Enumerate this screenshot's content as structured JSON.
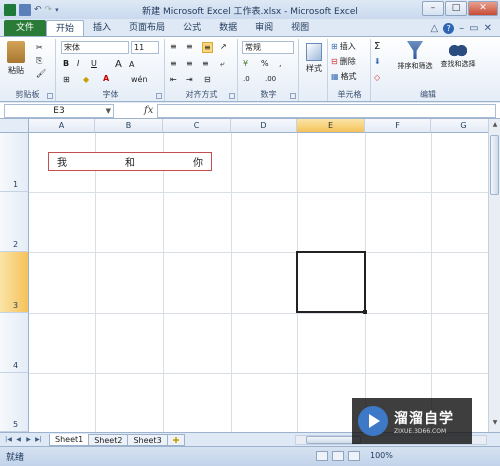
{
  "window": {
    "title": "新建 Microsoft Excel 工作表.xlsx - Microsoft Excel"
  },
  "tabs": [
    "文件",
    "开始",
    "插入",
    "页面布局",
    "公式",
    "数据",
    "审阅",
    "视图"
  ],
  "active_tab": "开始",
  "ribbon": {
    "clipboard": {
      "paste": "粘贴",
      "label": "剪贴板"
    },
    "font": {
      "name": "宋体",
      "size": "11",
      "bold": "B",
      "italic": "I",
      "underline": "U",
      "grow": "A",
      "shrink": "A",
      "color_a": "A",
      "wen": "wén",
      "label": "字体"
    },
    "alignment": {
      "label": "对齐方式"
    },
    "number": {
      "format": "常规",
      "percent": "%",
      "comma": ",",
      "dec_inc": ".0",
      "dec_dec": ".00",
      "label": "数字"
    },
    "styles": {
      "styles_btn": "样式",
      "label": ""
    },
    "cells": {
      "insert": "插入",
      "delete": "删除",
      "format": "格式",
      "label": "单元格"
    },
    "editing": {
      "sum": "Σ",
      "sort_filter": "排序和筛选",
      "find_select": "查找和选择",
      "label": "编辑"
    }
  },
  "formula_bar": {
    "name_box": "E3",
    "fx": "fx",
    "content": ""
  },
  "grid": {
    "columns": [
      "A",
      "B",
      "C",
      "D",
      "E",
      "F",
      "G"
    ],
    "rows": [
      "1",
      "2",
      "3",
      "4",
      "5"
    ],
    "selected_column": "E",
    "selected_row": "3",
    "textbox_words": [
      "我",
      "和",
      "你"
    ]
  },
  "sheets": [
    "Sheet1",
    "Sheet2",
    "Sheet3"
  ],
  "active_sheet": "Sheet1",
  "status": {
    "mode": "就绪",
    "zoom": "100%"
  },
  "watermark": {
    "brand": "溜溜自学",
    "url": "ZIXUE.3D66.COM"
  },
  "colors": {
    "file_tab": "#2a7b37",
    "selected_header": "#f5c25a",
    "textbox_border": "#c0504d"
  }
}
